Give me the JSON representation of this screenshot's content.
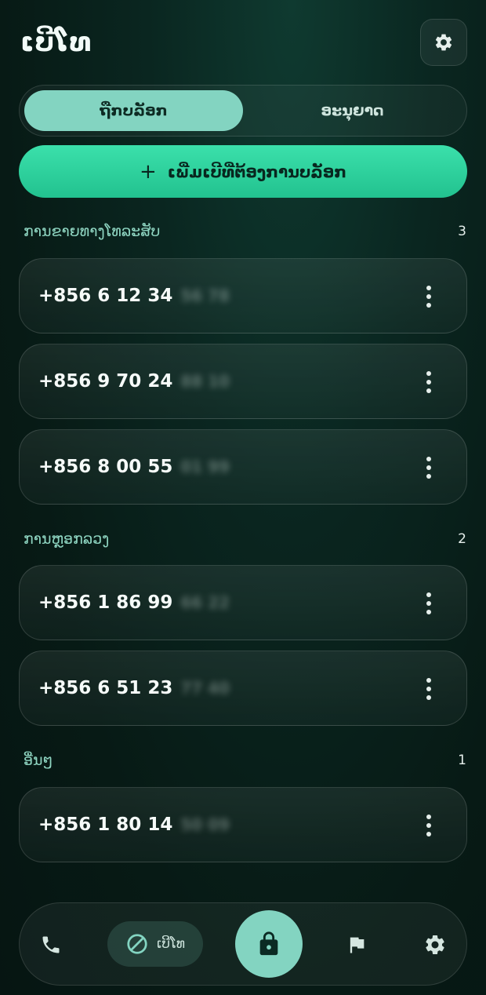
{
  "header": {
    "title": "ເບີໂທ"
  },
  "segmented": {
    "tabs": [
      {
        "label": "ຖືກບລັອກ",
        "active": true
      },
      {
        "label": "ອະນຸຍາດ",
        "active": false
      }
    ]
  },
  "add_button": {
    "icon": "+",
    "label": "ເພີ່ມເບີທີ່ຕ້ອງການບລັອກ"
  },
  "sections": [
    {
      "title": "ການຂາຍທາງໂທລະສັບ",
      "count": "3",
      "items": [
        {
          "visible": "+856 6 12 34",
          "masked": "56 78"
        },
        {
          "visible": "+856 9 70 24",
          "masked": "88 10"
        },
        {
          "visible": "+856 8 00 55",
          "masked": "01 99"
        }
      ]
    },
    {
      "title": "ການຫຼອກລວງ",
      "count": "2",
      "items": [
        {
          "visible": "+856 1 86 99",
          "masked": "66 22"
        },
        {
          "visible": "+856 6 51 23",
          "masked": "77 40"
        }
      ]
    },
    {
      "title": "ອື່ນໆ",
      "count": "1",
      "items": [
        {
          "visible": "+856 1 80 14",
          "masked": "50 09"
        }
      ]
    }
  ],
  "bottom_nav": {
    "items": [
      {
        "icon": "phone-icon"
      },
      {
        "icon": "block-icon",
        "label": "ເບີໂທ",
        "active": true
      },
      {
        "icon": "lock-icon"
      },
      {
        "icon": "flag-icon"
      },
      {
        "icon": "gear-icon"
      }
    ]
  },
  "colors": {
    "accent": "#83d4c1",
    "primary_button": "#2fd39f",
    "background": "#0a2620",
    "section_title": "#8fd6c2"
  }
}
